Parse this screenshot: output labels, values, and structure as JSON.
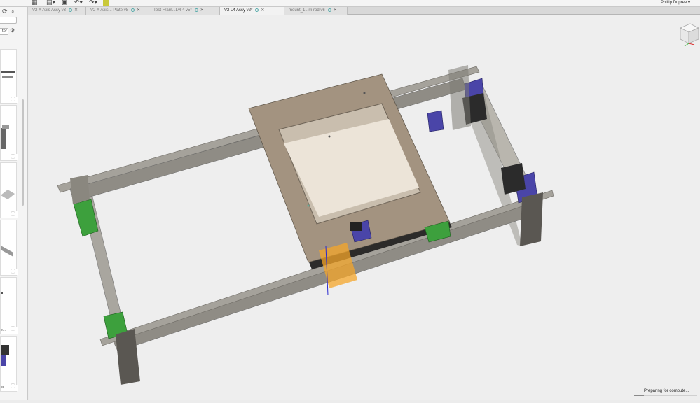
{
  "toolbar": {
    "grid_icon": "grid-icon",
    "file_icon": "file-icon",
    "save_icon": "save-icon",
    "undo_icon": "undo-icon",
    "redo_icon": "redo-icon"
  },
  "user": {
    "name": "Phillip Dupree ▾"
  },
  "tabs": [
    {
      "label": "V2 X Axis Assy v3",
      "active": false
    },
    {
      "label": "V2 X Axis... Plate v8",
      "active": false
    },
    {
      "label": "Test Fram...Lvl 4 v5*",
      "active": false
    },
    {
      "label": "V2 L4 Assy v2*",
      "active": true
    },
    {
      "label": "mount_1...m rod v6",
      "active": false
    }
  ],
  "sidebar": {
    "filter_label": "ter",
    "cards": [
      {
        "label": "",
        "icon": "gantry-thumbnail"
      },
      {
        "label": "",
        "icon": "frame-thumbnail"
      },
      {
        "label": "",
        "icon": "plate-thumbnail"
      },
      {
        "label": "",
        "icon": "rail-thumbnail"
      },
      {
        "label": "e...",
        "icon": "blank-thumbnail"
      },
      {
        "label": "el...",
        "icon": "motor-thumbnail"
      }
    ]
  },
  "status": {
    "text": "Preparing for compute...",
    "progress": 0.15
  },
  "colors": {
    "frame": "#b4b1aa",
    "plate": "#a39380",
    "bracket_green": "#3da03d",
    "bracket_blue": "#4a45a8",
    "selection": "#f4a62a"
  }
}
